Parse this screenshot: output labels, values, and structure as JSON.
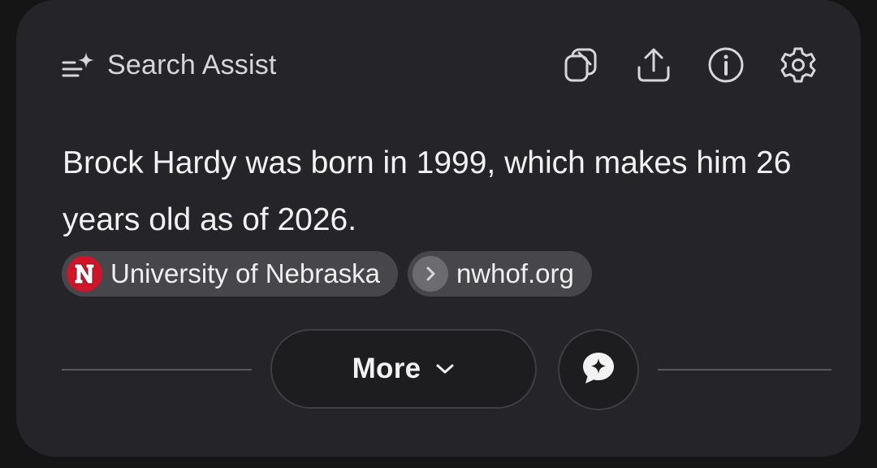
{
  "header": {
    "title": "Search Assist",
    "title_icon": "sparkle-lines-icon"
  },
  "toolbar": [
    {
      "name": "copy",
      "icon": "copy-icon"
    },
    {
      "name": "share",
      "icon": "share-icon"
    },
    {
      "name": "info",
      "icon": "info-icon"
    },
    {
      "name": "settings",
      "icon": "gear-icon"
    }
  ],
  "answer": {
    "text": "Brock Hardy was born in 1999, which makes him 26 years old as of 2026."
  },
  "sources": [
    {
      "label": "University of Nebraska",
      "icon": "nebraska-n-logo",
      "color": "#d0152b"
    },
    {
      "label": "nwhof.org",
      "icon": "chevron-right-icon",
      "color": "#6c6c70"
    }
  ],
  "actions": {
    "more_label": "More",
    "chat_icon": "chat-sparkle-icon"
  },
  "colors": {
    "background": "#151515",
    "card": "#252529",
    "chip": "#47474b",
    "text": "#f2f2f3"
  }
}
